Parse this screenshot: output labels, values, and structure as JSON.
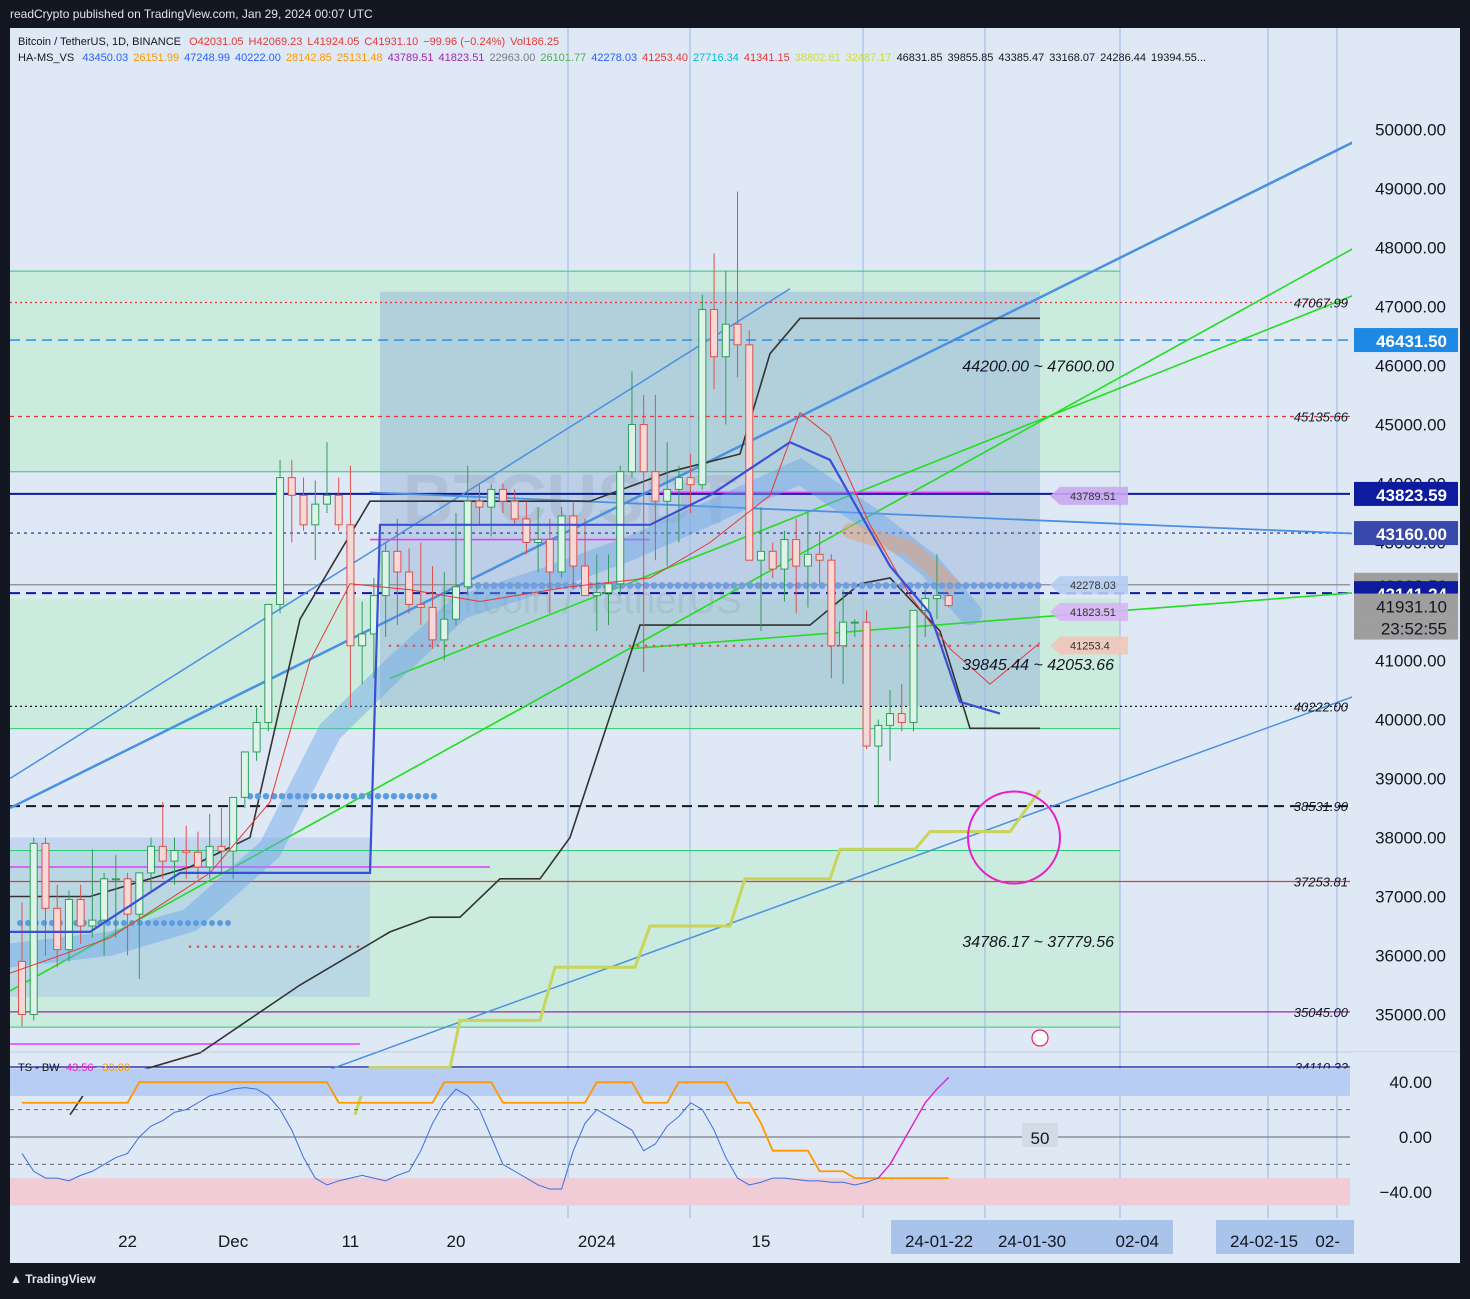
{
  "header": {
    "published": "readCrypto published on TradingView.com, Jan 29, 2024 00:07 UTC"
  },
  "legend": {
    "symbol": "Bitcoin / TetherUS, 1D, BINANCE",
    "ohlc": [
      {
        "text": "O42031.05",
        "color": "#e53935"
      },
      {
        "text": "H42069.23",
        "color": "#e53935"
      },
      {
        "text": "L41924.05",
        "color": "#e53935"
      },
      {
        "text": "C41931.10",
        "color": "#e53935"
      },
      {
        "text": "−99.96 (−0.24%)",
        "color": "#e53935"
      },
      {
        "text": "Vol186.25",
        "color": "#e53935"
      }
    ],
    "indicator_name": "HA-MS_VS",
    "indicator_values": [
      {
        "text": "43450.03",
        "color": "#2962ff"
      },
      {
        "text": "26151.99",
        "color": "#ff9800"
      },
      {
        "text": "47248.99",
        "color": "#2962ff"
      },
      {
        "text": "40222.00",
        "color": "#2962ff"
      },
      {
        "text": "28142.85",
        "color": "#ff9800"
      },
      {
        "text": "25131.48",
        "color": "#ff9800"
      },
      {
        "text": "43789.51",
        "color": "#9c27b0"
      },
      {
        "text": "41823.51",
        "color": "#9c27b0"
      },
      {
        "text": "22963.00",
        "color": "#787b86"
      },
      {
        "text": "26101.77",
        "color": "#4caf50"
      },
      {
        "text": "42278.03",
        "color": "#2962ff"
      },
      {
        "text": "41253.40",
        "color": "#e53935"
      },
      {
        "text": "27716.34",
        "color": "#00bcd4"
      },
      {
        "text": "41341.15",
        "color": "#e53935"
      },
      {
        "text": "38802.61",
        "color": "#cddc39"
      },
      {
        "text": "32487.17",
        "color": "#cddc39"
      },
      {
        "text": "46831.85",
        "color": "#131722"
      },
      {
        "text": "39855.85",
        "color": "#131722"
      },
      {
        "text": "43385.47",
        "color": "#131722"
      },
      {
        "text": "33168.07",
        "color": "#131722"
      },
      {
        "text": "24286.44",
        "color": "#131722"
      },
      {
        "text": "19394.55...",
        "color": "#131722"
      }
    ]
  },
  "watermark": {
    "ticker": "BTCUSDT",
    "name": "Bitcoin / TetherUS"
  },
  "chart_data": {
    "type": "candlestick",
    "symbol": "BTCUSDT",
    "timeframe": "1D",
    "x_start": "2023-11-13",
    "ylim": [
      33300,
      50500
    ],
    "y_ticks": [
      34000,
      35000,
      36000,
      37000,
      38000,
      39000,
      40000,
      41000,
      42000,
      43000,
      44000,
      45000,
      46000,
      47000,
      48000,
      49000,
      50000
    ],
    "candles": [
      [
        35900,
        36900,
        34800,
        35000
      ],
      [
        35000,
        38000,
        34900,
        37900
      ],
      [
        37900,
        38000,
        36000,
        36800
      ],
      [
        36800,
        37200,
        35800,
        36100
      ],
      [
        36100,
        37100,
        35900,
        36950
      ],
      [
        36950,
        37200,
        36200,
        36500
      ],
      [
        36500,
        37800,
        36300,
        36600
      ],
      [
        36600,
        37400,
        36000,
        37300
      ],
      [
        37300,
        37700,
        36300,
        37300
      ],
      [
        37300,
        37400,
        36000,
        36700
      ],
      [
        36700,
        37400,
        35600,
        37400
      ],
      [
        37400,
        38000,
        37100,
        37850
      ],
      [
        37850,
        38600,
        37300,
        37600
      ],
      [
        37600,
        38000,
        37200,
        37780
      ],
      [
        37780,
        38200,
        37300,
        37750
      ],
      [
        37750,
        38100,
        37300,
        37500
      ],
      [
        37500,
        38400,
        37300,
        37850
      ],
      [
        37850,
        38500,
        37400,
        37770
      ],
      [
        37770,
        38400,
        37300,
        38680
      ],
      [
        38680,
        39000,
        38500,
        39450
      ],
      [
        39450,
        40200,
        39300,
        39950
      ],
      [
        39950,
        41500,
        39800,
        41950
      ],
      [
        41950,
        44400,
        41800,
        44100
      ],
      [
        44100,
        44400,
        43000,
        43800
      ],
      [
        43800,
        44100,
        43200,
        43300
      ],
      [
        43300,
        44050,
        42700,
        43650
      ],
      [
        43650,
        44700,
        43500,
        43800
      ],
      [
        43800,
        44100,
        43200,
        43300
      ],
      [
        43300,
        44300,
        40200,
        41250
      ],
      [
        41250,
        42000,
        40600,
        41450
      ],
      [
        41450,
        42400,
        40700,
        42100
      ],
      [
        42100,
        43000,
        41400,
        42850
      ],
      [
        42850,
        43400,
        41600,
        42500
      ],
      [
        42500,
        42900,
        41800,
        41950
      ],
      [
        41950,
        43000,
        41600,
        41900
      ],
      [
        41900,
        42600,
        41200,
        41350
      ],
      [
        41350,
        42500,
        41000,
        41700
      ],
      [
        41700,
        43500,
        41600,
        42250
      ],
      [
        42250,
        44300,
        42100,
        43700
      ],
      [
        43700,
        44000,
        43300,
        43600
      ],
      [
        43600,
        44000,
        43100,
        43900
      ],
      [
        43900,
        44000,
        43500,
        43700
      ],
      [
        43700,
        43900,
        43300,
        43400
      ],
      [
        43400,
        43700,
        42800,
        43000
      ],
      [
        43000,
        43600,
        42500,
        43050
      ],
      [
        43050,
        43400,
        41800,
        42500
      ],
      [
        42500,
        43600,
        42400,
        43450
      ],
      [
        43450,
        43700,
        42200,
        42600
      ],
      [
        42600,
        43400,
        42300,
        42100
      ],
      [
        42100,
        42800,
        41500,
        42150
      ],
      [
        42150,
        42800,
        41600,
        42300
      ],
      [
        42300,
        44300,
        42100,
        44200
      ],
      [
        44200,
        45900,
        44100,
        45000
      ],
      [
        45000,
        45500,
        40800,
        44200
      ],
      [
        44200,
        45500,
        42700,
        43700
      ],
      [
        43700,
        44700,
        42600,
        43900
      ],
      [
        43900,
        44300,
        43000,
        44100
      ],
      [
        44100,
        44500,
        43500,
        43980
      ],
      [
        43980,
        47200,
        43900,
        46950
      ],
      [
        46950,
        47900,
        45600,
        46150
      ],
      [
        46150,
        47600,
        45000,
        46700
      ],
      [
        46700,
        48950,
        45800,
        46350
      ],
      [
        46350,
        46600,
        42700,
        42700
      ],
      [
        42700,
        43600,
        41500,
        42850
      ],
      [
        42850,
        43000,
        42400,
        42550
      ],
      [
        42550,
        43200,
        42000,
        43050
      ],
      [
        43050,
        43400,
        41800,
        42600
      ],
      [
        42600,
        43500,
        41900,
        42800
      ],
      [
        42800,
        43200,
        42300,
        42700
      ],
      [
        42700,
        42800,
        40700,
        41250
      ],
      [
        41250,
        42200,
        40600,
        41650
      ],
      [
        41650,
        41700,
        41400,
        41650
      ],
      [
        41650,
        41850,
        39500,
        39550
      ],
      [
        39550,
        40000,
        38550,
        39900
      ],
      [
        39900,
        40500,
        39300,
        40100
      ],
      [
        40100,
        40600,
        39800,
        39950
      ],
      [
        39950,
        41800,
        39800,
        41850
      ],
      [
        41850,
        42200,
        41400,
        42050
      ],
      [
        42050,
        42800,
        41700,
        42100
      ],
      [
        42100,
        42150,
        41900,
        41931
      ]
    ],
    "price_labels": [
      {
        "price": 47067.99,
        "text": "47067.99"
      },
      {
        "price": 45135.66,
        "text": "45135.66"
      },
      {
        "price": 40222.0,
        "text": "40222.00"
      },
      {
        "price": 38531.9,
        "text": "38531.90"
      },
      {
        "price": 37253.81,
        "text": "37253.81"
      },
      {
        "price": 35045.0,
        "text": "35045.00"
      },
      {
        "price": 34110.32,
        "text": "34110.32"
      }
    ],
    "axis_badges": [
      {
        "price": 46431.5,
        "text": "46431.50",
        "bg": "#1e88e5",
        "fg": "#ffffff"
      },
      {
        "price": 43823.59,
        "text": "43823.59",
        "bg": "#0d1b9e",
        "fg": "#ffffff"
      },
      {
        "price": 43160.0,
        "text": "43160.00",
        "bg": "#3949ab",
        "fg": "#ffffff"
      },
      {
        "price": 42283.58,
        "text": "42283.58",
        "bg": "#9e9e9e",
        "fg": "#131722"
      },
      {
        "price": 42141.24,
        "text": "42141.24",
        "bg": "#0d1b9e",
        "fg": "#ffffff"
      },
      {
        "price": 41931.1,
        "text": "41931.10",
        "bg": "#9e9e9e",
        "fg": "#131722"
      }
    ],
    "countdown": "23:52:55",
    "inline_tags": [
      {
        "price": 43789.51,
        "text": "43789.51",
        "bg": "#c9a8f0"
      },
      {
        "price": 42278.03,
        "text": "42278.03",
        "bg": "#b6cdf2"
      },
      {
        "price": 41823.51,
        "text": "41823.51",
        "bg": "#d8b4f5"
      },
      {
        "price": 41253.4,
        "text": "41253.4",
        "bg": "#f1c7b9"
      }
    ],
    "zone_labels": [
      {
        "text": "44200.00 ~ 47600.00",
        "price": 46000
      },
      {
        "text": "39845.44 ~ 42053.66",
        "price": 40940
      },
      {
        "text": "34786.17 ~ 37779.56",
        "price": 36250
      }
    ],
    "x_ticks": [
      {
        "text": "22",
        "i": 9
      },
      {
        "text": "Dec",
        "i": 18
      },
      {
        "text": "11",
        "i": 28
      },
      {
        "text": "20",
        "i": 37
      },
      {
        "text": "2024",
        "i": 49
      },
      {
        "text": "15",
        "i": 63
      }
    ],
    "x_date_boxes": [
      {
        "texts": [
          "24-01-22",
          "24-01-30",
          "02-04"
        ],
        "x0": 881,
        "x1": 1163
      },
      {
        "texts": [
          "24-02-15",
          "02-"
        ],
        "x0": 1206,
        "x1": 1344
      }
    ],
    "oscillator": {
      "title": "TS - BW",
      "value_a": "43.56",
      "value_b": "−30.00",
      "ylim": [
        -52,
        52
      ],
      "y_ticks": [
        "40.00",
        "0.00",
        "−40.00"
      ],
      "mid_label": "50",
      "bw_line": [
        25,
        25,
        25,
        25,
        25,
        25,
        25,
        25,
        25,
        25,
        40,
        40,
        40,
        40,
        40,
        40,
        40,
        40,
        40,
        40,
        40,
        40,
        40,
        40,
        40,
        40,
        40,
        25,
        25,
        25,
        25,
        25,
        25,
        25,
        25,
        25,
        40,
        40,
        40,
        40,
        40,
        25,
        25,
        25,
        25,
        25,
        25,
        25,
        25,
        40,
        40,
        40,
        40,
        25,
        25,
        25,
        40,
        40,
        40,
        40,
        40,
        25,
        25,
        10,
        -10,
        -10,
        -10,
        -10,
        -25,
        -25,
        -25,
        -30,
        -30,
        -30,
        -30,
        -30,
        -30,
        -30,
        -30,
        -30
      ],
      "ts_line": [
        -12,
        -25,
        -30,
        -30,
        -32,
        -28,
        -25,
        -20,
        -15,
        -12,
        0,
        8,
        12,
        18,
        20,
        25,
        30,
        32,
        35,
        36,
        35,
        30,
        20,
        5,
        -15,
        -30,
        -35,
        -32,
        -30,
        -28,
        -30,
        -32,
        -28,
        -25,
        -10,
        10,
        25,
        35,
        30,
        20,
        0,
        -20,
        -25,
        -30,
        -35,
        -38,
        -38,
        -10,
        10,
        20,
        15,
        10,
        5,
        -10,
        -5,
        8,
        15,
        25,
        20,
        5,
        -15,
        -30,
        -35,
        -33,
        -30,
        -30,
        -31,
        -32,
        -32,
        -33,
        -33,
        -35,
        -33,
        -30,
        -20,
        -5,
        10,
        25,
        35,
        43.56
      ]
    }
  },
  "footer": {
    "brand": "TradingView"
  }
}
